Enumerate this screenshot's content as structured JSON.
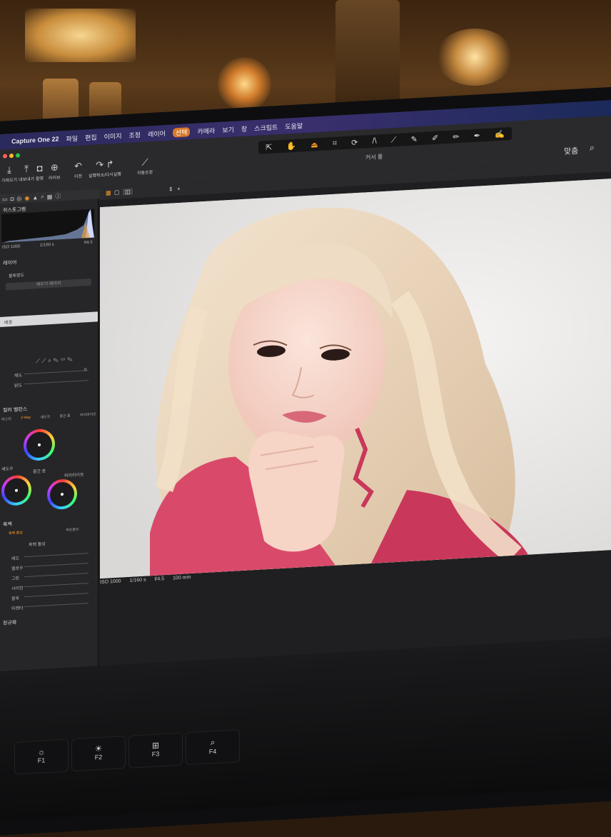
{
  "menubar": {
    "apple": "",
    "app": "Capture One 22",
    "items": [
      "파일",
      "편집",
      "이미지",
      "조정",
      "레이어",
      "선택",
      "카메라",
      "보기",
      "창",
      "스크립트",
      "도움말"
    ]
  },
  "toolbar": {
    "buttons": [
      {
        "label": "가져오기",
        "icon": "import-icon"
      },
      {
        "label": "내보내기",
        "icon": "export-icon"
      },
      {
        "label": "촬영",
        "icon": "capture-icon"
      },
      {
        "label": "라이브",
        "icon": "live-icon"
      },
      {
        "label": "이전",
        "icon": "undo-icon"
      },
      {
        "label": "실행취소/다시실행",
        "icon": "redo-icon"
      },
      {
        "label": "자동조정",
        "icon": "auto-adjust-icon"
      }
    ],
    "cursor_tools_label": "커서 툴",
    "fit_label": "맞춤",
    "zoom_icon": "zoom-icon"
  },
  "left_panel": {
    "histogram_title": "히스토그램",
    "exif": {
      "iso": "ISO 1000",
      "shutter": "1/160 s",
      "aperture": "f/4.5"
    },
    "layers_title": "레이어",
    "layer_opacity": "불투명도",
    "layer_fill": "채우기 레이어",
    "layer_background": "배경",
    "slider_a": "채도",
    "slider_b": "밝도",
    "slider_a_value": "0",
    "color_balance_title": "컬러 밸런스",
    "color_tabs": [
      "마스터",
      "3-Way",
      "섀도우",
      "중간 톤",
      "하이라이트"
    ],
    "wheel_labels": {
      "shadow": "섀도우",
      "mid": "중간 톤",
      "high": "하이라이트"
    },
    "bw_title": "흑백",
    "bw_tab_active": "흑백 활성",
    "bw_tab_other": "색조분리",
    "bw_check": "흑백 활성",
    "bw_sliders": [
      "레드",
      "옐로우",
      "그린",
      "사이언",
      "블루",
      "마젠타"
    ],
    "sharpness_title": "정규화"
  },
  "viewer": {
    "exif_bottom": {
      "iso": "ISO 1000",
      "shutter": "1/160 s",
      "aperture": "f/4.5",
      "focal": "100 mm"
    }
  },
  "keyboard": {
    "keys": [
      {
        "symbol": "☼",
        "label": "F1"
      },
      {
        "symbol": "☀",
        "label": "F2"
      },
      {
        "symbol": "⊞",
        "label": "F3"
      },
      {
        "symbol": "⌕",
        "label": "F4"
      }
    ]
  },
  "colors": {
    "accent": "#ff9a2a",
    "menubar": "#2b2a5c",
    "panel": "#262628"
  }
}
